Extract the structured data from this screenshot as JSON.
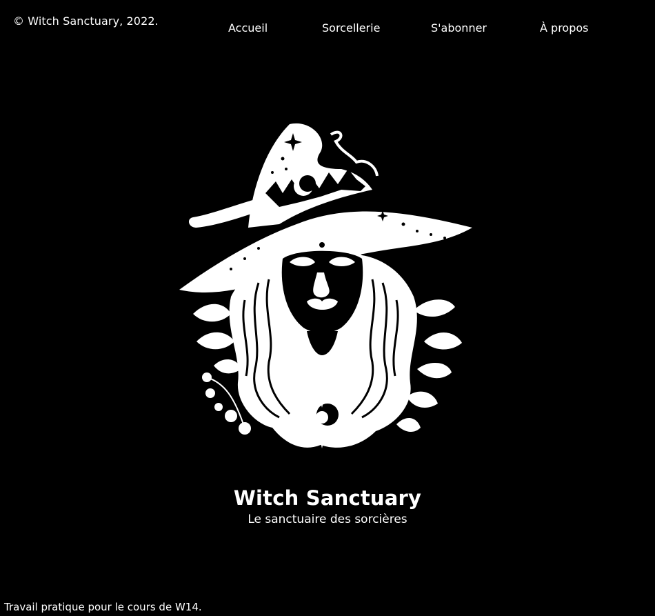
{
  "copyright": "© Witch Sanctuary, 2022.",
  "nav": {
    "items": [
      {
        "label": "Accueil"
      },
      {
        "label": "Sorcellerie"
      },
      {
        "label": "S'abonner"
      },
      {
        "label": "À propos"
      }
    ]
  },
  "logo": {
    "icon": "witch-illustration-icon"
  },
  "hero": {
    "title": "Witch Sanctuary",
    "subtitle": "Le sanctuaire des sorcières"
  },
  "footer": {
    "note": "Travail pratique pour le cours de W14."
  },
  "colors": {
    "background": "#000000",
    "text": "#ffffff"
  }
}
